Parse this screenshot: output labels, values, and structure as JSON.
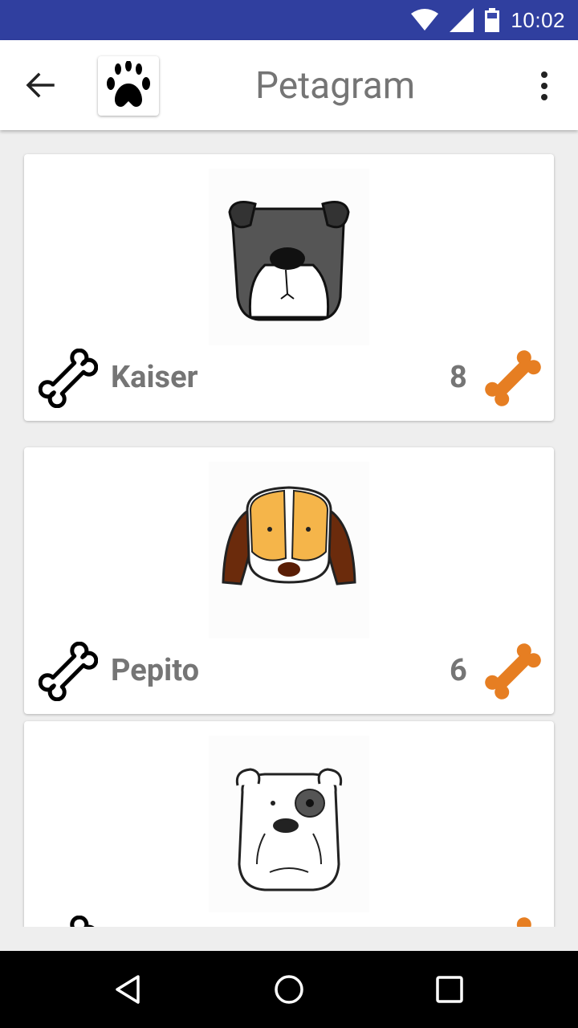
{
  "status_bar": {
    "time": "10:02",
    "icons": [
      "wifi-icon",
      "signal-icon",
      "battery-icon"
    ]
  },
  "app_bar": {
    "title": "Petagram",
    "logo": "paw-icon",
    "back": "arrow-back-icon",
    "menu": "more-vert-icon"
  },
  "colors": {
    "status_bar": "#303f9f",
    "bone_accent": "#e67e22",
    "text_gray": "#757575"
  },
  "pets": [
    {
      "name": "Kaiser",
      "likes": "8",
      "photo": "gray-dog-face"
    },
    {
      "name": "Pepito",
      "likes": "6",
      "photo": "orange-brown-dog-face"
    },
    {
      "name": "",
      "likes": "",
      "photo": "white-bulldog-face"
    }
  ],
  "nav_bar": [
    "back-triangle-icon",
    "home-circle-icon",
    "recents-square-icon"
  ]
}
